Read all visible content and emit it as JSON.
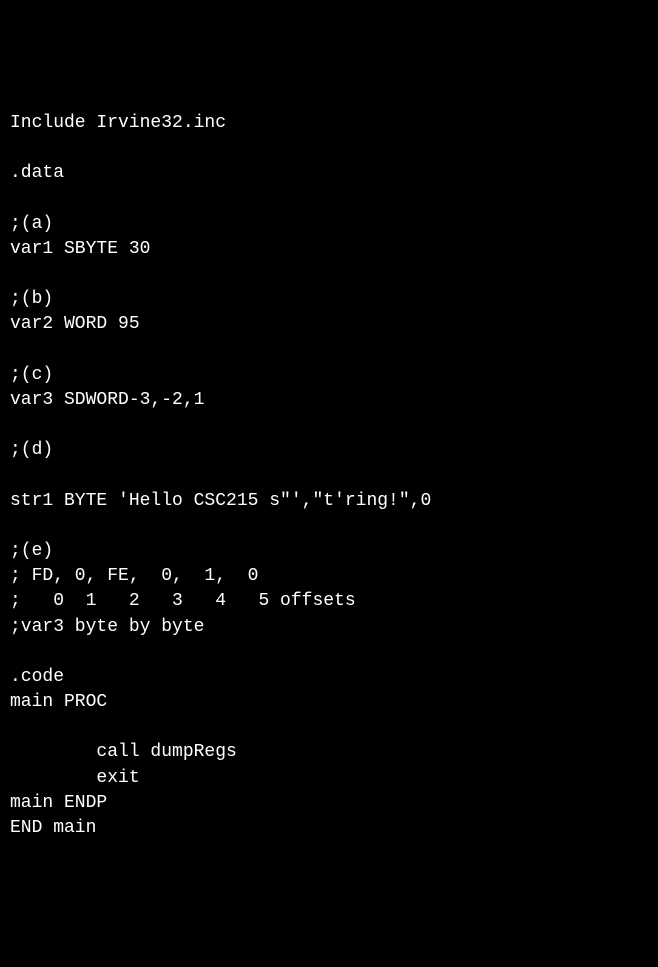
{
  "code": {
    "line1": "Include Irvine32.inc",
    "line2": "",
    "line3": ".data",
    "line4": "",
    "line5": ";(a)",
    "line6": "var1 SBYTE 30",
    "line7": "",
    "line8": ";(b)",
    "line9": "var2 WORD 95",
    "line10": "",
    "line11": ";(c)",
    "line12": "var3 SDWORD-3,-2,1",
    "line13": "",
    "line14": ";(d)",
    "line15": "",
    "line16": "str1 BYTE 'Hello CSC215 s\"',\"t'ring!\",0",
    "line17": "",
    "line18": ";(e)",
    "line19": "; FD, 0, FE,  0,  1,  0",
    "line20": ";   0  1   2   3   4   5 offsets",
    "line21": ";var3 byte by byte",
    "line22": "",
    "line23": ".code",
    "line24": "main PROC",
    "line25": "",
    "line26": "        call dumpRegs",
    "line27": "        exit",
    "line28": "main ENDP",
    "line29": "END main"
  }
}
